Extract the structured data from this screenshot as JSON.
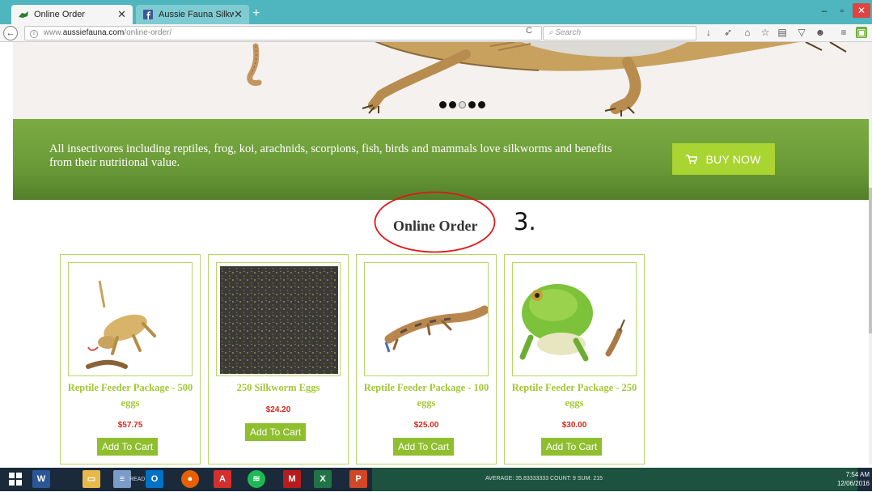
{
  "browser": {
    "tabs": [
      {
        "title": "Online Order",
        "active": true
      },
      {
        "title": "Aussie Fauna Silkworms",
        "active": false
      }
    ],
    "new_tab": "+",
    "window_controls": {
      "minimize": "–",
      "maximize": "▫",
      "close": "✕"
    },
    "url": {
      "prefix": "www.",
      "host": "aussiefauna.com",
      "path": "/online-order/"
    },
    "search_placeholder": "Search",
    "toolbar_icons": [
      "download-icon",
      "send-icon",
      "home-icon",
      "star-icon",
      "library-icon",
      "pocket-icon",
      "pocket-icon-2",
      "menu-icon",
      "extension-icon"
    ]
  },
  "hero": {
    "slides": 5,
    "current_slide": 3
  },
  "banner": {
    "text": "All insectivores including reptiles, frog, koi, arachnids, scorpions, fish, birds and mammals love silkworms and benefits from their nutritional value.",
    "button_label": "BUY NOW"
  },
  "section": {
    "title": "Online Order",
    "annotation": "3."
  },
  "products": [
    {
      "name": "Reptile Feeder Package - 500 eggs",
      "price": "$57.75",
      "button": "Add To Cart"
    },
    {
      "name": "250 Silkworm Eggs",
      "price": "$24.20",
      "button": "Add To Cart"
    },
    {
      "name": "Reptile Feeder Package - 100 eggs",
      "price": "$25.00",
      "button": "Add To Cart"
    },
    {
      "name": "Reptile Feeder Package - 250 eggs",
      "price": "$30.00",
      "button": "Add To Cart"
    }
  ],
  "taskbar": {
    "ready": "READY",
    "status": "AVERAGE: 35.83333333    COUNT: 9    SUM: 215",
    "time": "7:54 AM",
    "date": "12/06/2016"
  },
  "colors": {
    "tab_bar": "#4fb6bf",
    "banner_green": "#6a9a37",
    "buy_button": "#a9d431",
    "product_name": "#a2c836",
    "price": "#d4271b",
    "add_button": "#8fbe2f",
    "annotation": "#e0161b"
  }
}
